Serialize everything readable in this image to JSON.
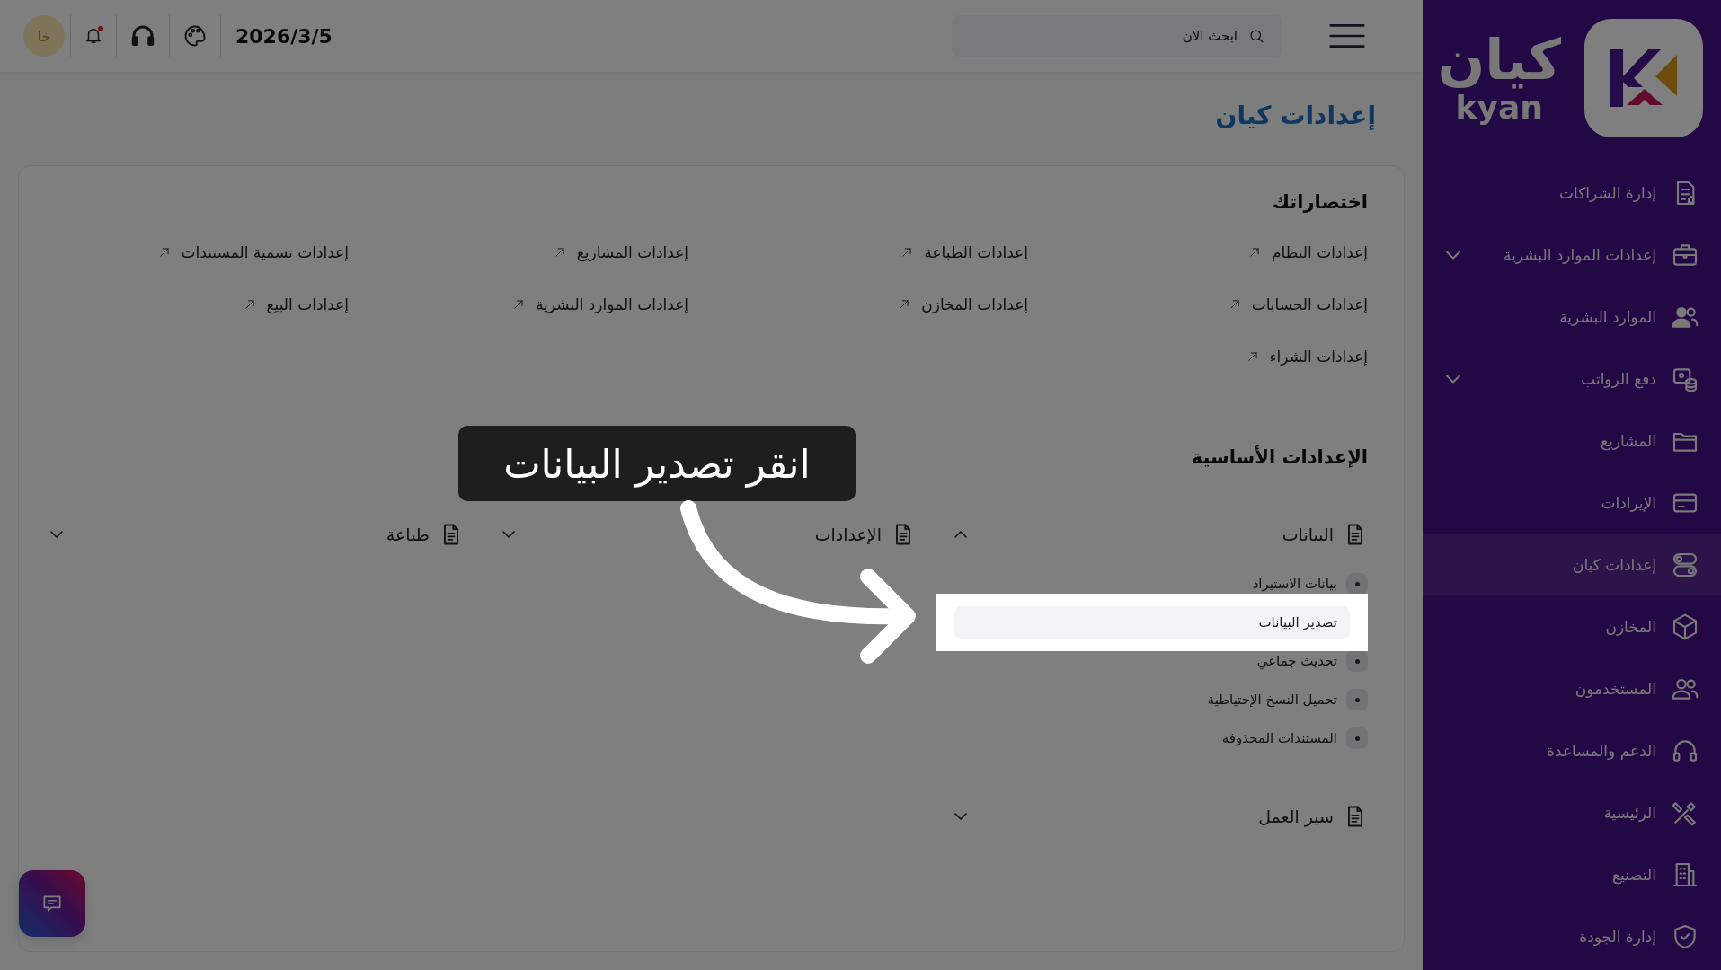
{
  "sidebar": {
    "logo": {
      "arabic": "كيان",
      "latin": "kyan"
    },
    "items": [
      {
        "label": "إدارة الشراكات",
        "selected": false,
        "expandable": false
      },
      {
        "label": "إعدادات الموارد البشرية",
        "selected": false,
        "expandable": true
      },
      {
        "label": "الموارد البشرية",
        "selected": false,
        "expandable": false
      },
      {
        "label": "دفع الرواتب",
        "selected": false,
        "expandable": true
      },
      {
        "label": "المشاريع",
        "selected": false,
        "expandable": false
      },
      {
        "label": "الإيرادات",
        "selected": false,
        "expandable": false
      },
      {
        "label": "إعدادات كيان",
        "selected": true,
        "expandable": false
      },
      {
        "label": "المخازن",
        "selected": false,
        "expandable": false
      },
      {
        "label": "المستخدمون",
        "selected": false,
        "expandable": false
      },
      {
        "label": "الدعم والمساعدة",
        "selected": false,
        "expandable": false
      },
      {
        "label": "الرئيسية",
        "selected": false,
        "expandable": false
      },
      {
        "label": "التصنيع",
        "selected": false,
        "expandable": false
      },
      {
        "label": "إدارة الجودة",
        "selected": false,
        "expandable": false
      }
    ]
  },
  "topbar": {
    "search": {
      "placeholder": "ابحث الان"
    },
    "date": "2026/3/5",
    "has_unread_notifications": true,
    "avatar": "خا"
  },
  "page_title": "إعدادات كيان",
  "shortcuts": {
    "title": "اختصاراتك",
    "items": [
      "إعدادات النظام",
      "إعدادات الطباعة",
      "إعدادات المشاريع",
      "إعدادات تسمية المستندات",
      "إعدادات الحسابات",
      "إعدادات المخازن",
      "إعدادات الموارد البشرية",
      "إعدادات البيع",
      "إعدادات الشراء"
    ]
  },
  "basic_settings": {
    "title": "الإعدادات الأساسية",
    "groups": [
      {
        "label": "البيانات",
        "expanded": true,
        "children": [
          {
            "label": "بيانات الاستيراد",
            "selected": false
          },
          {
            "label": "تصدير البيانات",
            "selected": true
          },
          {
            "label": "تحديث جماعي",
            "selected": false
          },
          {
            "label": "تحميل النسخ الإحتياطية",
            "selected": false
          },
          {
            "label": "المستندات المحذوفة",
            "selected": false
          }
        ]
      },
      {
        "label": "الإعدادات",
        "expanded": false
      },
      {
        "label": "طباعة",
        "expanded": false
      },
      {
        "label": "سير العمل",
        "expanded": false
      }
    ]
  },
  "tutorial": {
    "text": "انقر تصدير البيانات"
  }
}
